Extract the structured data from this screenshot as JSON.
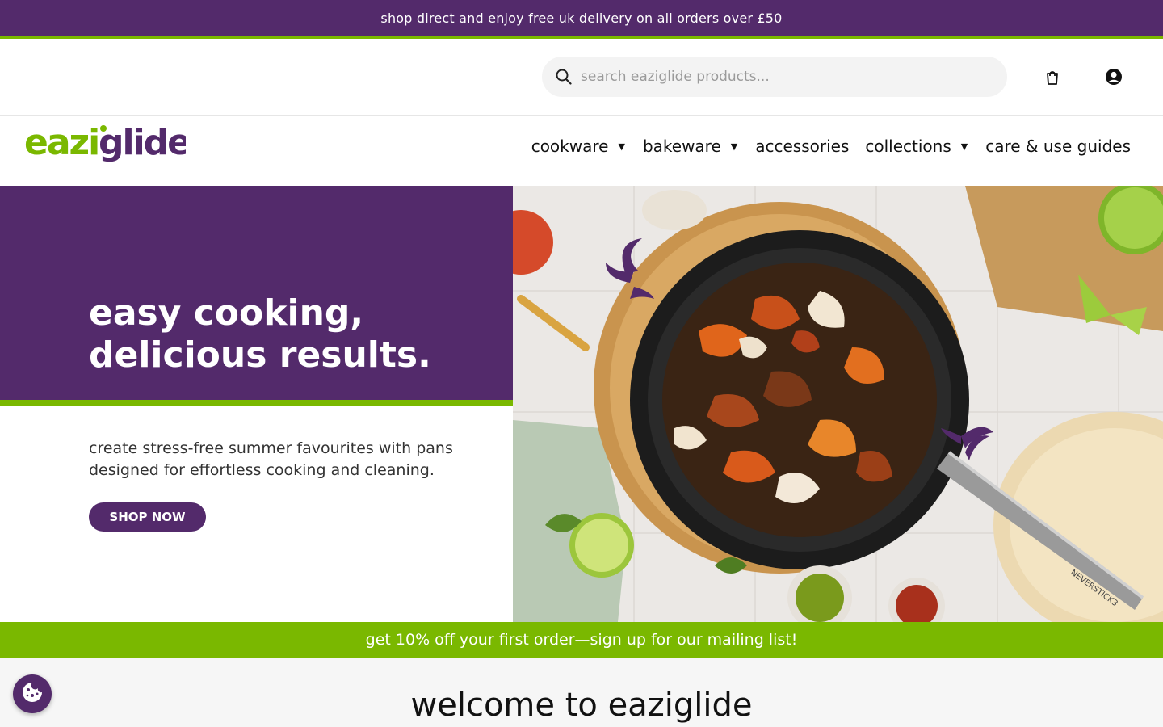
{
  "announcement": "shop direct and enjoy free uk delivery on all orders over £50",
  "search": {
    "placeholder": "search eaziglide products..."
  },
  "logo": {
    "text": "eaziglide"
  },
  "nav": {
    "items": [
      {
        "label": "cookware",
        "has_dropdown": true
      },
      {
        "label": "bakeware",
        "has_dropdown": true
      },
      {
        "label": "accessories",
        "has_dropdown": false
      },
      {
        "label": "collections",
        "has_dropdown": true
      },
      {
        "label": "care & use guides",
        "has_dropdown": false
      }
    ]
  },
  "hero": {
    "headline_line1": "easy cooking,",
    "headline_line2": "delicious results.",
    "subtext_line1": "create stress-free summer favourites with pans",
    "subtext_line2": "designed for effortless cooking and cleaning.",
    "cta": "SHOP NOW",
    "pan_brand": "NEVERSTICK3"
  },
  "promo": "get 10% off your first order—sign up for our mailing list!",
  "welcome": "welcome to eaziglide",
  "colors": {
    "brand_purple": "#532a6b",
    "brand_green": "#7ab800"
  }
}
